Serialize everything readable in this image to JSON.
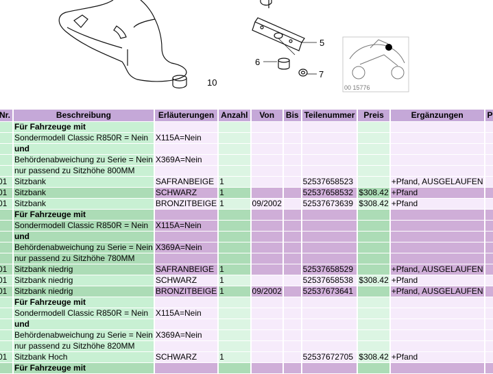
{
  "diagram": {
    "callouts": [
      "5",
      "6",
      "7",
      "10"
    ],
    "thumbnail_code": "00 15776"
  },
  "table": {
    "columns": [
      "Nr.",
      "Beschreibung",
      "Erläuterungen",
      "Anzahl",
      "Von",
      "Bis",
      "Teilenummer",
      "Preis",
      "Ergänzungen",
      "Ph"
    ],
    "groups": [
      {
        "style": "g",
        "header_lines": [
          [
            "Für Fahrzeuge mit",
            "",
            true
          ],
          [
            "Sondermodell Classic R850R = Nein",
            "X115A=Nein",
            false
          ],
          [
            "und",
            "",
            true
          ],
          [
            "Behördenabweichung zu Serie = Nein",
            "X369A=Nein",
            false
          ],
          [
            "nur passend zu Sitzhöhe 800MM",
            "",
            false
          ]
        ],
        "rows": [
          {
            "nr": "01",
            "desc": "Sitzbank",
            "erl": "SAFRANBEIGE",
            "anz": "1",
            "von": "",
            "bis": "",
            "tnr": "52537658523",
            "preis": "",
            "erg": "+Pfand, AUSGELAUFEN",
            "style": "g"
          },
          {
            "nr": "01",
            "desc": "Sitzbank",
            "erl": "SCHWARZ",
            "anz": "1",
            "von": "",
            "bis": "",
            "tnr": "52537658532",
            "preis": "$308.42",
            "erg": "+Pfand",
            "style": "p"
          },
          {
            "nr": "01",
            "desc": "Sitzbank",
            "erl": "BRONZITBEIGE",
            "anz": "1",
            "von": "09/2002",
            "bis": "",
            "tnr": "52537673639",
            "preis": "$308.42",
            "erg": "+Pfand",
            "style": "g"
          }
        ]
      },
      {
        "style": "p",
        "header_lines": [
          [
            "Für Fahrzeuge mit",
            "",
            true
          ],
          [
            "Sondermodell Classic R850R = Nein",
            "X115A=Nein",
            false
          ],
          [
            "und",
            "",
            true
          ],
          [
            "Behördenabweichung zu Serie = Nein",
            "X369A=Nein",
            false
          ],
          [
            "nur passend zu Sitzhöhe 780MM",
            "",
            false
          ]
        ],
        "rows": [
          {
            "nr": "01",
            "desc": "Sitzbank niedrig",
            "erl": "SAFRANBEIGE",
            "anz": "1",
            "von": "",
            "bis": "",
            "tnr": "52537658529",
            "preis": "",
            "erg": "+Pfand, AUSGELAUFEN",
            "style": "p"
          },
          {
            "nr": "01",
            "desc": "Sitzbank niedrig",
            "erl": "SCHWARZ",
            "anz": "1",
            "von": "",
            "bis": "",
            "tnr": "52537658538",
            "preis": "$308.42",
            "erg": "+Pfand",
            "style": "g"
          },
          {
            "nr": "01",
            "desc": "Sitzbank niedrig",
            "erl": "BRONZITBEIGE",
            "anz": "1",
            "von": "09/2002",
            "bis": "",
            "tnr": "52537673641",
            "preis": "",
            "erg": "+Pfand, AUSGELAUFEN",
            "style": "p"
          }
        ]
      },
      {
        "style": "g",
        "header_lines": [
          [
            "Für Fahrzeuge mit",
            "",
            true
          ],
          [
            "Sondermodell Classic R850R = Nein",
            "X115A=Nein",
            false
          ],
          [
            "und",
            "",
            true
          ],
          [
            "Behördenabweichung zu Serie = Nein",
            "X369A=Nein",
            false
          ],
          [
            "nur passend zu Sitzhöhe 820MM",
            "",
            false
          ]
        ],
        "rows": [
          {
            "nr": "01",
            "desc": "Sitzbank Hoch",
            "erl": "SCHWARZ",
            "anz": "1",
            "von": "",
            "bis": "",
            "tnr": "52537672705",
            "preis": "$308.42",
            "erg": "+Pfand",
            "style": "g"
          }
        ]
      },
      {
        "style": "p",
        "header_lines": [
          [
            "Für Fahrzeuge mit",
            "",
            true
          ]
        ],
        "rows": []
      }
    ]
  }
}
